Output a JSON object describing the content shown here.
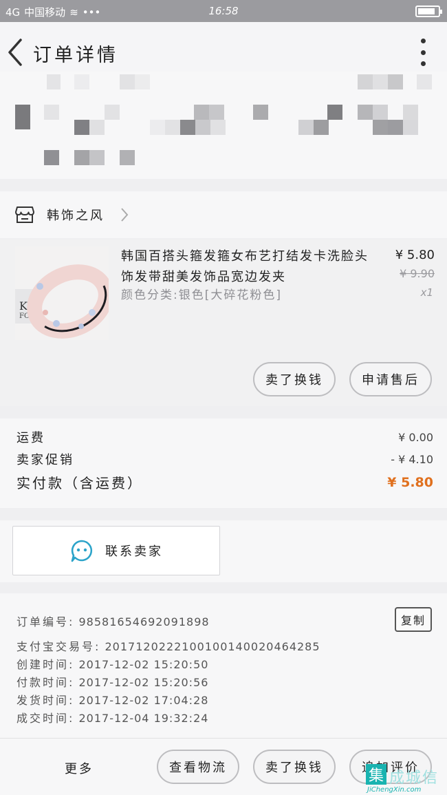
{
  "status_bar": {
    "carrier": "中国移动",
    "signal": "4G",
    "time": "16:58",
    "battery_level": 0.85
  },
  "nav": {
    "title": "订单详情"
  },
  "shop": {
    "name": "韩饰之风"
  },
  "product": {
    "title": "韩国百搭头箍发箍女布艺打结发卡洗脸头饰发带甜美发饰品宽边发夹",
    "sku": "颜色分类:银色[大碎花粉色]",
    "price": "¥ 5.80",
    "original_price": "¥ 9.90",
    "qty": "x1",
    "btn_return": "卖了换钱",
    "btn_aftersale": "申请售后"
  },
  "costs": {
    "shipping_label": "运费",
    "shipping_value": "¥ 0.00",
    "promo_label": "卖家促销",
    "promo_value": "- ¥ 4.10",
    "total_label": "实付款（含运费）",
    "total_value": "¥ 5.80"
  },
  "contact": {
    "label": "联系卖家"
  },
  "order_info": {
    "order_no_label": "订单编号:",
    "order_no": "98581654692091898",
    "copy_label": "复制",
    "alipay_label": "支付宝交易号:",
    "alipay_no": "2017120222100100140020464285",
    "created_label": "创建时间:",
    "created": "2017-12-02 15:20:50",
    "paid_label": "付款时间:",
    "paid": "2017-12-02 15:20:56",
    "shipped_label": "发货时间:",
    "shipped": "2017-12-02 17:04:28",
    "done_label": "成交时间:",
    "done": "2017-12-04 19:32:24"
  },
  "bottom": {
    "more": "更多",
    "logistics": "查看物流",
    "resell": "卖了换钱",
    "review": "追加评价"
  },
  "watermark": {
    "logo": "集",
    "brand": "成城信",
    "url": "JiChengXin.com"
  },
  "colors": {
    "total_accent": "#e0701e",
    "watermark": "#19b3b0"
  }
}
